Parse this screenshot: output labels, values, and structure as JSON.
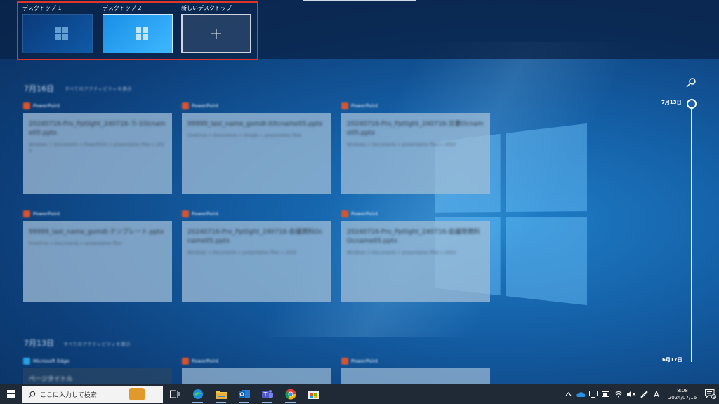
{
  "desktops": [
    {
      "label": "デスクトップ 1"
    },
    {
      "label": "デスクトップ 2"
    },
    {
      "label": "新しいデスクトップ",
      "plus": "+"
    }
  ],
  "timeline": {
    "section1": {
      "title": "7月16日",
      "subtitle": "すべてのアクティビティを表示"
    },
    "section2": {
      "title": "7月13日",
      "subtitle": "すべてのアクティビティを表示"
    },
    "cards_row1": [
      {
        "app": "PowerPoint",
        "title": "20240716-Pro_Pptlight_240716-ラ-1Ocname05.pptx",
        "meta": "Windows > Documents > PowerPoint > presentation files > 2024"
      },
      {
        "app": "PowerPoint",
        "title": "99999_last_name_gsmdt-XXcname05.pptx",
        "meta": "OneDrive > Documents > Google > presentation files"
      },
      {
        "app": "PowerPoint",
        "title": "20240716-Pro_Pptlight_240716-文書Ocname05.pptx",
        "meta": "Windows > Documents > presentation files > 2024"
      }
    ],
    "cards_row2": [
      {
        "app": "PowerPoint",
        "title": "99999_last_name_gsmdt-テンプレート.pptx",
        "meta": "OneDrive > Documents > presentation files"
      },
      {
        "app": "PowerPoint",
        "title": "20240716-Pro_Pptlight_240716-会議資料Ocname05.pptx",
        "meta": "Windows > Documents > presentation files > 2024"
      },
      {
        "app": "PowerPoint",
        "title": "20240716-Pro_Pptlight_240716-会議用資料Ocname05.pptx",
        "meta": "Windows > Documents > presentation files > 2024"
      }
    ],
    "cards_row3": [
      {
        "app": "Microsoft Edge",
        "title": "ページタイトル"
      },
      {
        "app": "PowerPoint",
        "title": ""
      },
      {
        "app": "PowerPoint",
        "title": ""
      }
    ],
    "dates": {
      "top": "7月13日",
      "bottom": "6月17日"
    }
  },
  "taskbar": {
    "search_placeholder": "ここに入力して検索",
    "clock_time": "8:08",
    "clock_date": "2024/07/16",
    "ime": "A",
    "notification_count": "4"
  }
}
